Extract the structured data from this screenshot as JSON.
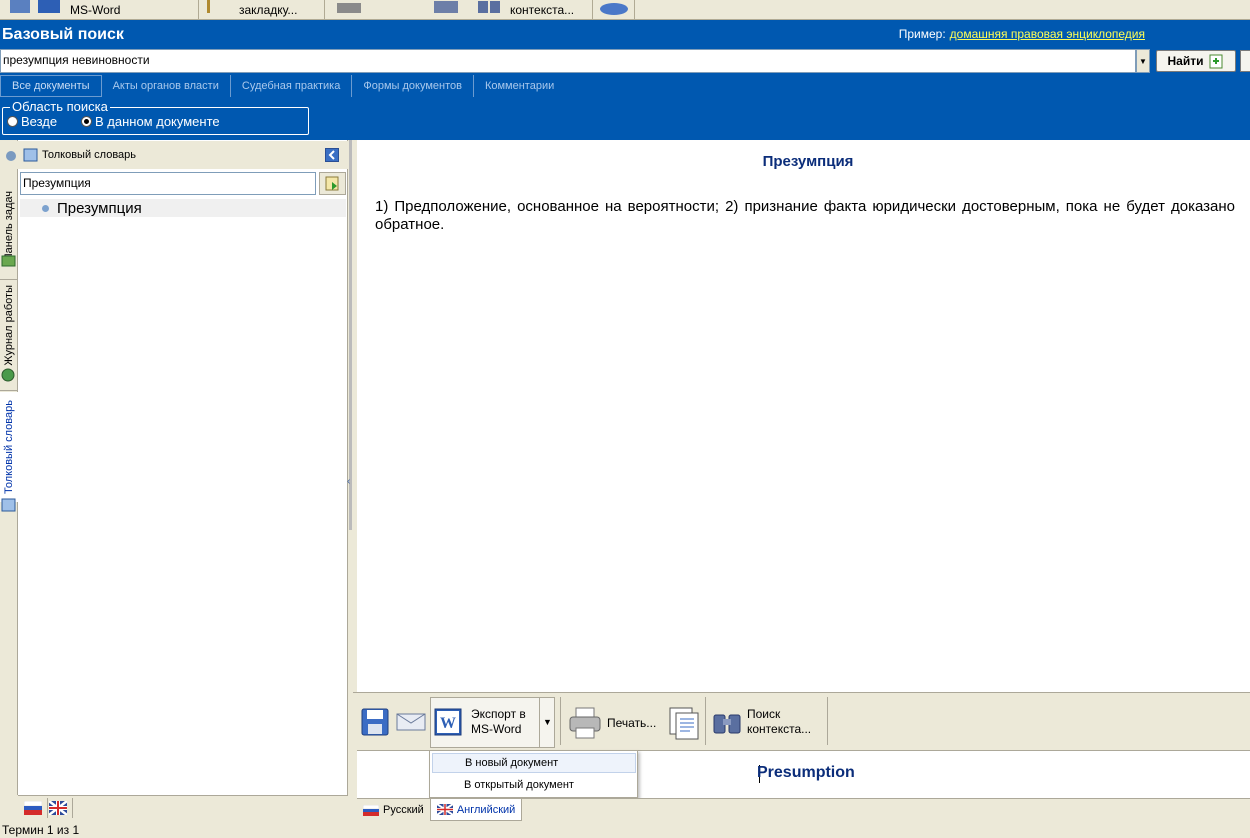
{
  "top_toolbar": {
    "items": [
      "MS-Word",
      "закладку...",
      "контекста..."
    ]
  },
  "header": {
    "title": "Базовый поиск",
    "example_label": "Пример:",
    "example_link": "домашняя правовая энциклопедия"
  },
  "search": {
    "value": "презумпция невиновности",
    "find_label": "Найти"
  },
  "tabs": [
    "Все документы",
    "Акты органов власти",
    "Судебная практика",
    "Формы документов",
    "Комментарии"
  ],
  "search_area": {
    "legend": "Область поиска",
    "options": [
      "Везде",
      "В данном документе"
    ],
    "selected": "В данном документе"
  },
  "side_tabs": [
    "Панель задач",
    "Журнал работы",
    "Толковый словарь"
  ],
  "left_panel": {
    "title": "Толковый словарь",
    "search_value": "Презумпция",
    "items": [
      "Презумпция"
    ]
  },
  "content": {
    "title": "Презумпция",
    "text": "1) Предположение, основанное на вероятности; 2) признание факта юридически достоверным, пока не будет доказано обратное."
  },
  "content_toolbar": {
    "export_label_1": "Экспорт в",
    "export_label_2": "MS-Word",
    "print_label": "Печать...",
    "search_ctx_1": "Поиск",
    "search_ctx_2": "контекста..."
  },
  "export_menu": {
    "items": [
      "В новый документ",
      "В открытый документ"
    ],
    "highlighted": "В новый документ"
  },
  "english_title": "Presumption",
  "lang_tabs": [
    "Русский",
    "Английский"
  ],
  "active_lang": "Английский",
  "status": "Термин 1 из 1",
  "colors": {
    "header_blue": "#0058b0",
    "title_navy": "#0b2d7a",
    "link_yellow": "#ffff55"
  }
}
